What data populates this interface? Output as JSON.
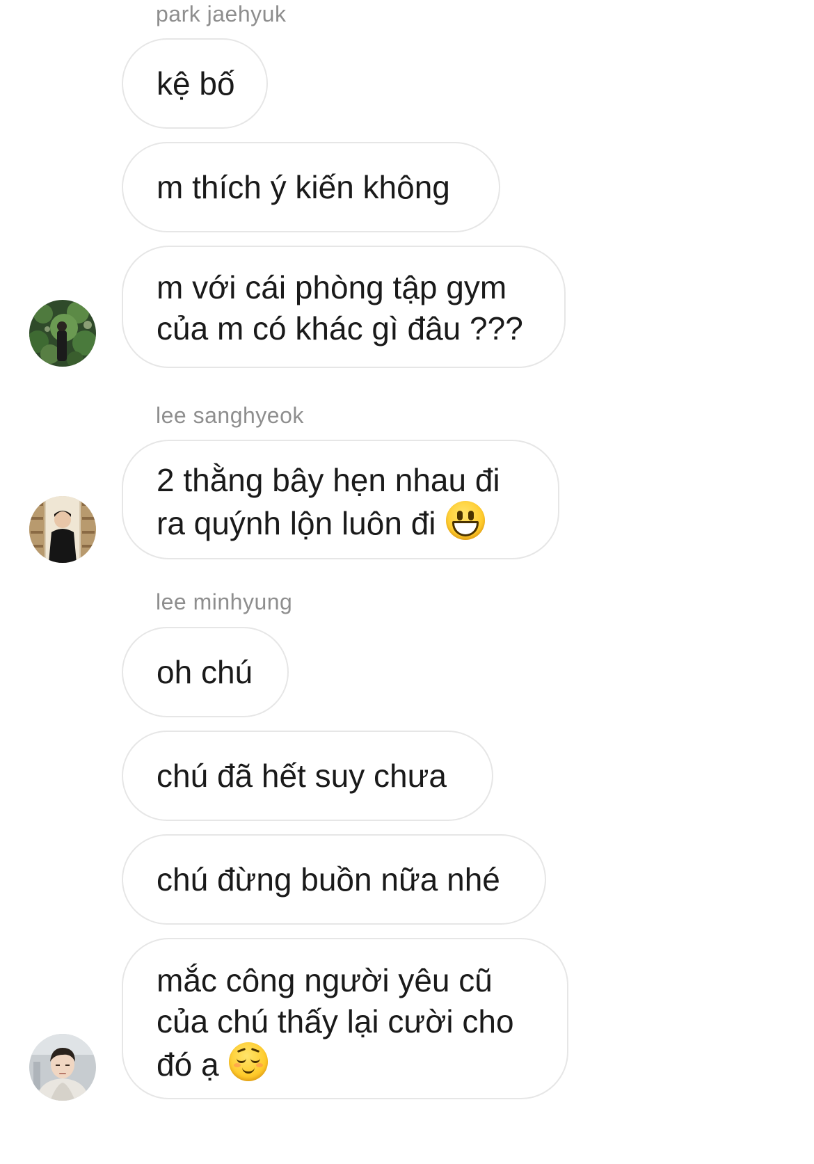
{
  "thread": {
    "groups": [
      {
        "sender": "park jaehyuk",
        "avatar": "avatar-park-jaehyuk",
        "messages": [
          {
            "lines": [
              "kệ bố"
            ]
          },
          {
            "lines": [
              "m thích ý kiến không"
            ]
          },
          {
            "lines": [
              "m với cái phòng tập gym",
              "của m có khác gì đâu ???"
            ]
          }
        ]
      },
      {
        "sender": "lee sanghyeok",
        "avatar": "avatar-lee-sanghyeok",
        "messages": [
          {
            "lines": [
              "2 thằng bây hẹn nhau đi",
              "ra quýnh lộn luôn đi"
            ],
            "emoji": "grinning-face-emoji"
          }
        ]
      },
      {
        "sender": "lee minhyung",
        "avatar": "avatar-lee-minhyung",
        "messages": [
          {
            "lines": [
              "oh chú"
            ]
          },
          {
            "lines": [
              "chú đã hết suy chưa"
            ]
          },
          {
            "lines": [
              "chú đừng buồn nữa nhé"
            ]
          },
          {
            "lines": [
              "mắc công người yêu cũ",
              "của chú thấy lại cười cho",
              "đó ạ"
            ],
            "emoji": "relieved-face-emoji"
          }
        ]
      }
    ]
  },
  "colors": {
    "sender_text": "#8e8e8e",
    "bubble_border": "#e6e6e6",
    "message_text": "#1a1a1a",
    "background": "#ffffff"
  }
}
